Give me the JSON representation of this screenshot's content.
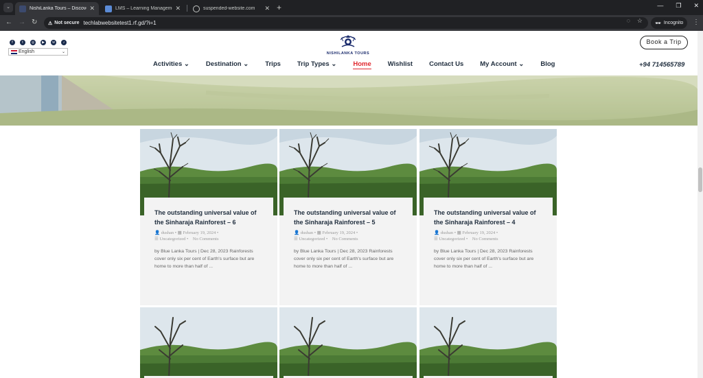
{
  "browser": {
    "tabs": [
      {
        "title": "NishiLanka Tours – Discover Sri",
        "active": true
      },
      {
        "title": "LMS – Learning Management Sy",
        "active": false
      },
      {
        "title": "suspended-website.com",
        "active": false
      }
    ],
    "address": {
      "security_label": "Not secure",
      "url": "techlabwebsitetest1.rf.gd/?i=1"
    },
    "incognito_label": "Incognito"
  },
  "site": {
    "language": "English",
    "logo_text": "NISHILANKA TOURS",
    "book_button": "Book a Trip",
    "phone": "+94 714565789",
    "nav": [
      {
        "label": "Activities",
        "dropdown": true,
        "active": false
      },
      {
        "label": "Destination",
        "dropdown": true,
        "active": false
      },
      {
        "label": "Trips",
        "dropdown": false,
        "active": false
      },
      {
        "label": "Trip Types",
        "dropdown": true,
        "active": false
      },
      {
        "label": "Home",
        "dropdown": false,
        "active": true
      },
      {
        "label": "Wishlist",
        "dropdown": false,
        "active": false
      },
      {
        "label": "Contact Us",
        "dropdown": false,
        "active": false
      },
      {
        "label": "My Account",
        "dropdown": true,
        "active": false
      },
      {
        "label": "Blog",
        "dropdown": false,
        "active": false
      }
    ],
    "posts": [
      {
        "title": "The outstanding universal value of the Sinharaja Rainforest – 6",
        "author": "dushan",
        "date": "February 19, 2024",
        "category": "Uncategorized",
        "comments": "No Comments",
        "excerpt": "by Blue Lanka Tours | Dec 28, 2023 Rainforests cover only six per cent of Earth's surface but are home to more than half of ..."
      },
      {
        "title": "The outstanding universal value of the Sinharaja Rainforest – 5",
        "author": "dushan",
        "date": "February 19, 2024",
        "category": "Uncategorized",
        "comments": "No Comments",
        "excerpt": "by Blue Lanka Tours | Dec 28, 2023 Rainforests cover only six per cent of Earth's surface but are home to more than half of ..."
      },
      {
        "title": "The outstanding universal value of the Sinharaja Rainforest – 4",
        "author": "dushan",
        "date": "February 19, 2024",
        "category": "Uncategorized",
        "comments": "No Comments",
        "excerpt": "by Blue Lanka Tours | Dec 28, 2023 Rainforests cover only six per cent of Earth's surface but are home to more than half of ..."
      }
    ]
  }
}
